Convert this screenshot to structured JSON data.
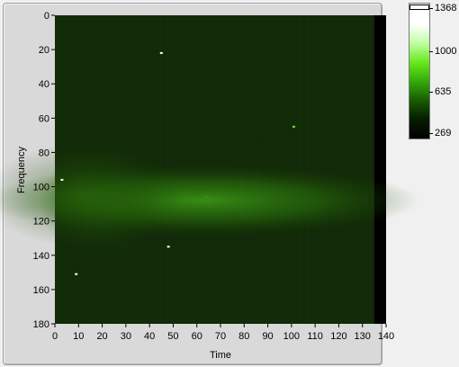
{
  "chart_data": {
    "type": "heatmap",
    "title": "",
    "xlabel": "Time",
    "ylabel": "Frequency",
    "xlim": [
      0,
      140
    ],
    "ylim": [
      180,
      0
    ],
    "x_ticks": [
      "0",
      "10",
      "20",
      "30",
      "40",
      "50",
      "60",
      "70",
      "80",
      "90",
      "100",
      "110",
      "120",
      "130",
      "140"
    ],
    "y_ticks": [
      "0",
      "20",
      "40",
      "60",
      "80",
      "100",
      "120",
      "140",
      "160",
      "180"
    ],
    "data_extent": {
      "time": [
        0,
        135
      ],
      "frequency": [
        0,
        180
      ]
    },
    "colormap": [
      "#000000",
      "#0a2a02",
      "#1f6a06",
      "#4ed20e",
      "#b7ff92",
      "#ffffff"
    ],
    "colorbar": {
      "min": 269,
      "max": 1368,
      "labels": [
        "1368",
        "1000",
        "635",
        "269"
      ]
    },
    "background_level": 300,
    "blobs": [
      {
        "time": 63,
        "frequency": 108,
        "level": 520
      },
      {
        "time": 12,
        "frequency": 105,
        "level": 430
      },
      {
        "time": 20,
        "frequency": 110,
        "level": 380
      }
    ],
    "hot_pixels": [
      {
        "time": 45,
        "frequency": 22,
        "level": 1368
      },
      {
        "time": 101,
        "frequency": 65,
        "level": 1000
      },
      {
        "time": 3,
        "frequency": 96,
        "level": 1368
      },
      {
        "time": 64,
        "frequency": 106,
        "level": 800
      },
      {
        "time": 48,
        "frequency": 135,
        "level": 1368
      },
      {
        "time": 9,
        "frequency": 151,
        "level": 1368
      },
      {
        "time": 78,
        "frequency": 23,
        "level": 520
      },
      {
        "time": 86,
        "frequency": 73,
        "level": 480
      },
      {
        "time": 104,
        "frequency": 178,
        "level": 500
      }
    ]
  }
}
